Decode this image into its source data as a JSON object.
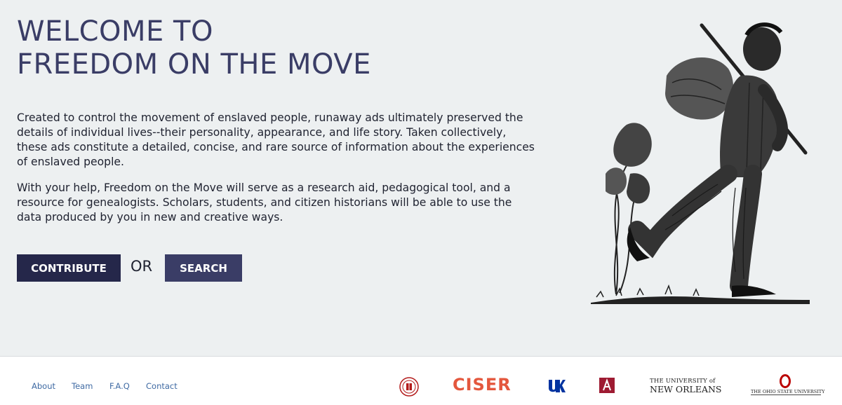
{
  "hero": {
    "title_line1": "WELCOME TO",
    "title_line2": "FREEDOM ON THE MOVE",
    "paragraph1": "Created to control the movement of enslaved people, runaway ads ultimately preserved the details of individual lives--their personality, appearance, and life story. Taken collectively, these ads constitute a detailed, concise, and rare source of information about the experiences of enslaved people.",
    "paragraph2": "With your help, Freedom on the Move will serve as a research aid, pedagogical tool, and a resource for genealogists. Scholars, students, and citizen historians will be able to use the data produced by you in new and creative ways.",
    "contribute_label": "CONTRIBUTE",
    "or_label": "OR",
    "search_label": "SEARCH"
  },
  "footer": {
    "links": [
      "About",
      "Team",
      "F.A.Q",
      "Contact"
    ],
    "logos": {
      "ciser": "CISER",
      "uno_line1": "THE UNIVERSITY of",
      "uno_line2": "NEW ORLEANS",
      "osu": "THE OHIO STATE UNIVERSITY"
    }
  },
  "colors": {
    "hero_bg": "#edf0f1",
    "title": "#3a3d66",
    "button_dark": "#25274a",
    "button": "#3a3d66",
    "link": "#3f6aa3",
    "ciser": "#e4573d",
    "kentucky": "#0033a0",
    "alabama": "#9e1b32",
    "osu": "#bb0000"
  }
}
